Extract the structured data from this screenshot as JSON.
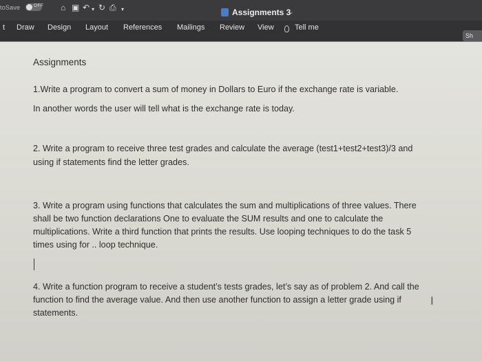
{
  "titlebar": {
    "autosave_label": "toSave",
    "autosave_state": "OFF",
    "document_title": "Assignments 3"
  },
  "ribbon": {
    "tabs": [
      "t",
      "Draw",
      "Design",
      "Layout",
      "References",
      "Mailings",
      "Review",
      "View"
    ],
    "tell_me": "Tell me",
    "share_label": "Sh"
  },
  "document": {
    "heading": "Assignments",
    "lines": {
      "q1_line1": "1.Write a program to convert a sum of money in Dollars to Euro if the exchange rate is variable.",
      "q1_line2": "In another words the user will tell what is the exchange rate is today.",
      "q2_line1": "2. Write a program to receive three test grades and calculate the average (test1+test2+test3)/3 and",
      "q2_line2": "using if statements find the letter grades.",
      "q3_line1": "3. Write a program using functions that calculates the sum and multiplications of three values. There",
      "q3_line2": "shall be two function declarations One to evaluate the SUM results and one to calculate the",
      "q3_line3": "multiplications. Write a third function that prints the results.  Use looping techniques to do the task 5",
      "q3_line4": "times using for .. loop technique.",
      "q4_line1": "4. Write a function program to receive a student’s tests grades, let’s say as of problem 2.  And call the",
      "q4_line2": "function to find the average value. And then use another function to assign a letter grade using if",
      "q4_line3": "statements."
    }
  }
}
